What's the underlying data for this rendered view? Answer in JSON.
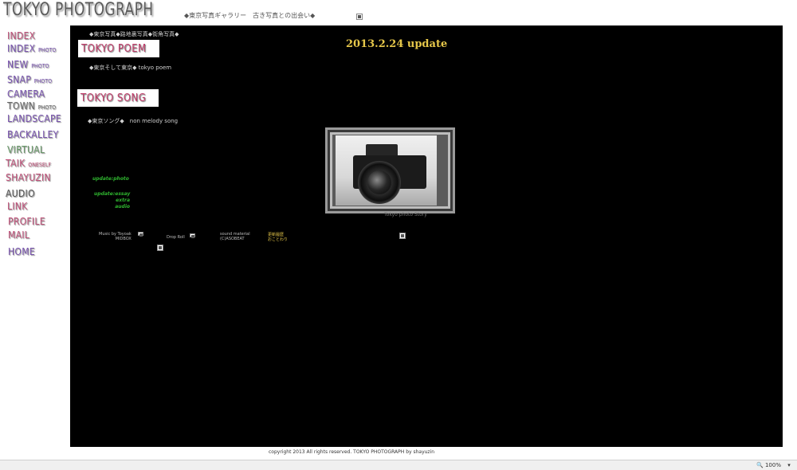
{
  "header": {
    "site_title": "TOKYO PHOTOGRAPH",
    "subtitle": "◆東京写真ギャラリー　古き写真との出会い◆"
  },
  "sidebar": {
    "items": [
      {
        "main": "INDEX",
        "sub": "",
        "color": "#c0527a"
      },
      {
        "main": "INDEX",
        "sub": "PHOTO",
        "color": "#7a55b0"
      },
      {
        "main": "NEW",
        "sub": "PHOTO",
        "color": "#7a55b0"
      },
      {
        "main": "SNAP",
        "sub": "PHOTO",
        "color": "#7a55b0"
      },
      {
        "main": "CAMERA",
        "sub": "",
        "color": "#7a55b0"
      },
      {
        "main": "TOWN",
        "sub": "PHOTO",
        "color": "#6a6a6a"
      },
      {
        "main": "LANDSCAPE",
        "sub": "",
        "color": "#7a55b0"
      },
      {
        "main": "BACKALLEY",
        "sub": "",
        "color": "#7a55b0"
      },
      {
        "main": "VIRTUAL",
        "sub": "",
        "color": "#6a9a6a"
      },
      {
        "main": "TAIK",
        "sub": "ONESELF",
        "color": "#c0527a"
      },
      {
        "main": "SHAYUZIN",
        "sub": "",
        "color": "#c0527a"
      },
      {
        "main": "AUDIO",
        "sub": "",
        "color": "#555555"
      },
      {
        "main": "LINK",
        "sub": "",
        "color": "#c0527a"
      },
      {
        "main": "PROFILE",
        "sub": "",
        "color": "#c0527a"
      },
      {
        "main": "MAIL",
        "sub": "",
        "color": "#c0527a"
      },
      {
        "main": "HOME",
        "sub": "",
        "color": "#7a55b0"
      }
    ]
  },
  "main": {
    "breadcrumb": "◆東京写真◆路地裏写真◆街角写真◆",
    "update_title": "2013.2.24 update",
    "poem_banner": "TOKYO POEM",
    "poem_link": "◆東京そして東京◆ tokyo poem",
    "song_banner": "TOKYO SONG",
    "song_link": "◆東京ソング◆　non melody song",
    "update_photo": "update:photo",
    "update_essay_lines": [
      "update:essay",
      "extra",
      "audio"
    ],
    "photo_caption": "Tokyo photo  Story",
    "credit_music": [
      "Music by Toyoak",
      "MIDBOX"
    ],
    "credit_drop": "Drop Roll",
    "credit_sound": [
      "sound material",
      "(C)ASOBEAT"
    ],
    "credit_update": [
      "更新履歴",
      "おことわり"
    ]
  },
  "footer": {
    "copyright": "copyright 2013  All rights reserved. TOKYO PHOTOGRAPH by shayuzin"
  },
  "statusbar": {
    "zoom": "100%"
  }
}
